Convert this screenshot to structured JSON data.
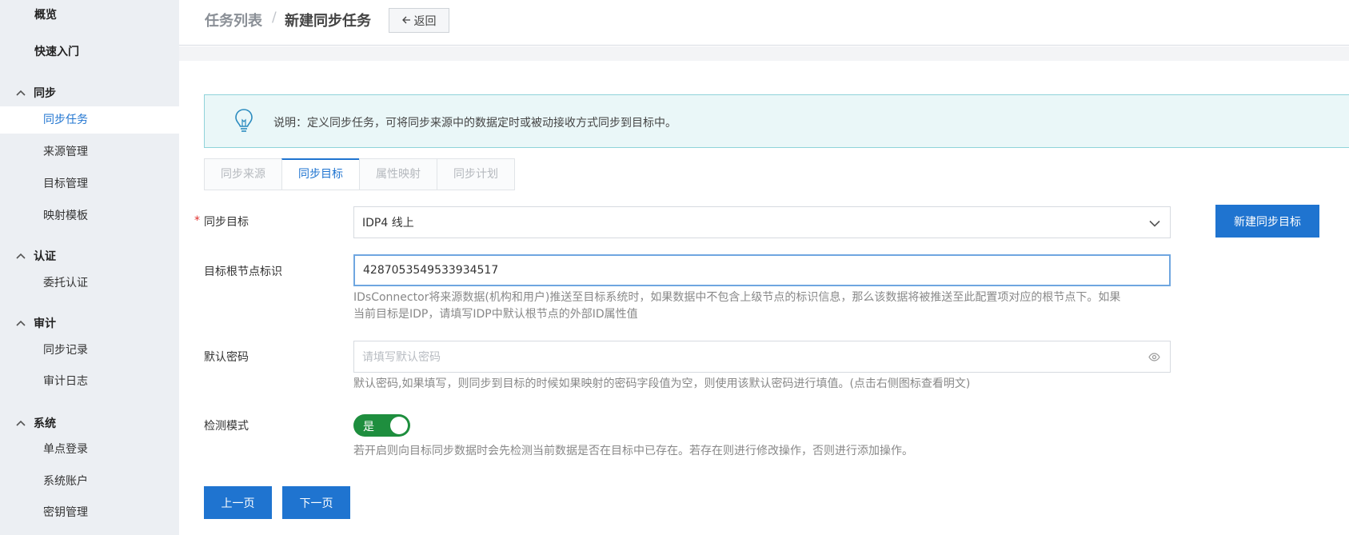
{
  "sidebar": {
    "overview": "概览",
    "quickstart": "快速入门",
    "groups": [
      {
        "label": "同步",
        "items": [
          "同步任务",
          "来源管理",
          "目标管理",
          "映射模板"
        ]
      },
      {
        "label": "认证",
        "items": [
          "委托认证"
        ]
      },
      {
        "label": "审计",
        "items": [
          "同步记录",
          "审计日志"
        ]
      },
      {
        "label": "系统",
        "items": [
          "单点登录",
          "系统账户",
          "密钥管理"
        ]
      }
    ],
    "active_item": "同步任务"
  },
  "header": {
    "breadcrumb_parent": "任务列表",
    "separator": "/",
    "breadcrumb_current": "新建同步任务",
    "back_label": "返回"
  },
  "info": {
    "text": "说明：定义同步任务，可将同步来源中的数据定时或被动接收方式同步到目标中。"
  },
  "tabs": [
    "同步来源",
    "同步目标",
    "属性映射",
    "同步计划"
  ],
  "active_tab": "同步目标",
  "form": {
    "target": {
      "label": "同步目标",
      "value": "IDP4 线上",
      "new_button": "新建同步目标"
    },
    "root": {
      "label": "目标根节点标识",
      "value": "4287053549533934517",
      "help_line1": "IDsConnector将来源数据(机构和用户)推送至目标系统时，如果数据中不包含上级节点的标识信息，那么该数据将被推送至此配置项对应的根节点下。如果",
      "help_line2": "当前目标是IDP，请填写IDP中默认根节点的外部ID属性值"
    },
    "password": {
      "label": "默认密码",
      "placeholder": "请填写默认密码",
      "help": "默认密码,如果填写，则同步到目标的时候如果映射的密码字段值为空，则使用该默认密码进行填值。(点击右侧图标查看明文)"
    },
    "detect": {
      "label": "检测模式",
      "toggle_label": "是",
      "enabled": true,
      "help": "若开启则向目标同步数据时会先检测当前数据是否在目标中已存在。若存在则进行修改操作，否则进行添加操作。"
    }
  },
  "buttons": {
    "prev": "上一页",
    "next": "下一页"
  },
  "colors": {
    "primary": "#1f74d0",
    "toggle_on": "#1e8e3e",
    "required": "#e0302d",
    "info_bg": "#eaf7f8"
  }
}
